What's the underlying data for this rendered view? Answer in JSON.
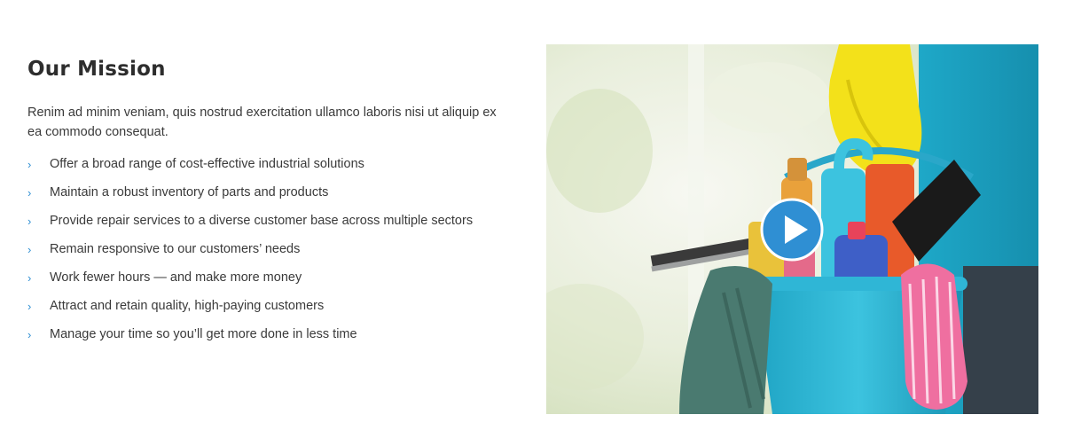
{
  "mission": {
    "title": "Our Mission",
    "intro": "Renim ad minim veniam, quis nostrud exercitation ullamco laboris nisi ut aliquip ex ea commodo consequat.",
    "bullet_icon": "chevron-right-icon",
    "items": [
      "Offer a broad range of cost-effective industrial solutions",
      "Maintain a robust inventory of parts and products",
      "Provide repair services to a diverse customer base across multiple sectors",
      "Remain responsive to our customers’ needs",
      "Work fewer hours — and make more money",
      "Attract and retain quality, high-paying customers",
      "Manage your time so you’ll get more done in less time"
    ]
  },
  "video": {
    "play_icon": "play-icon",
    "accent_color": "#2f8fd3"
  }
}
